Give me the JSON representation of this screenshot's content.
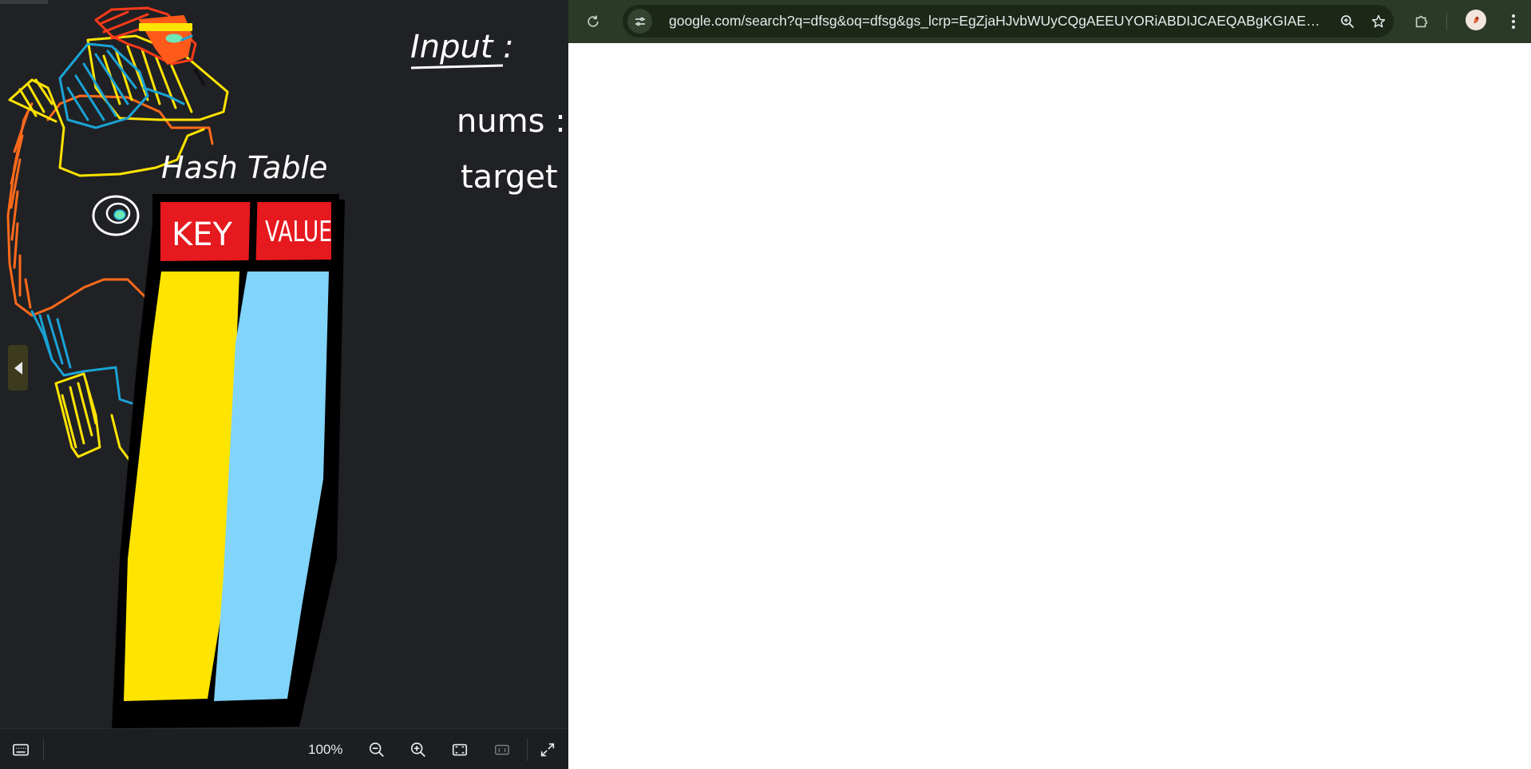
{
  "whiteboard": {
    "labels": {
      "hash_table": "Hash Table",
      "input": "Input :",
      "nums": "nums :",
      "target": "target",
      "key": "KEY",
      "value": "VALUE"
    },
    "toolbar": {
      "zoom_level": "100%"
    }
  },
  "browser": {
    "url": "google.com/search?q=dfsg&oq=dfsg&gs_lcrp=EgZjaHJvbWUyCQgAEEUYORiABDIJCAEQABgKGIAEMg8IA..."
  },
  "colors": {
    "board_bg": "#202124",
    "key_column": "#ffe400",
    "value_column": "#81d4fa",
    "header_red": "#e5191e",
    "browser_bar": "#2b3a27"
  }
}
